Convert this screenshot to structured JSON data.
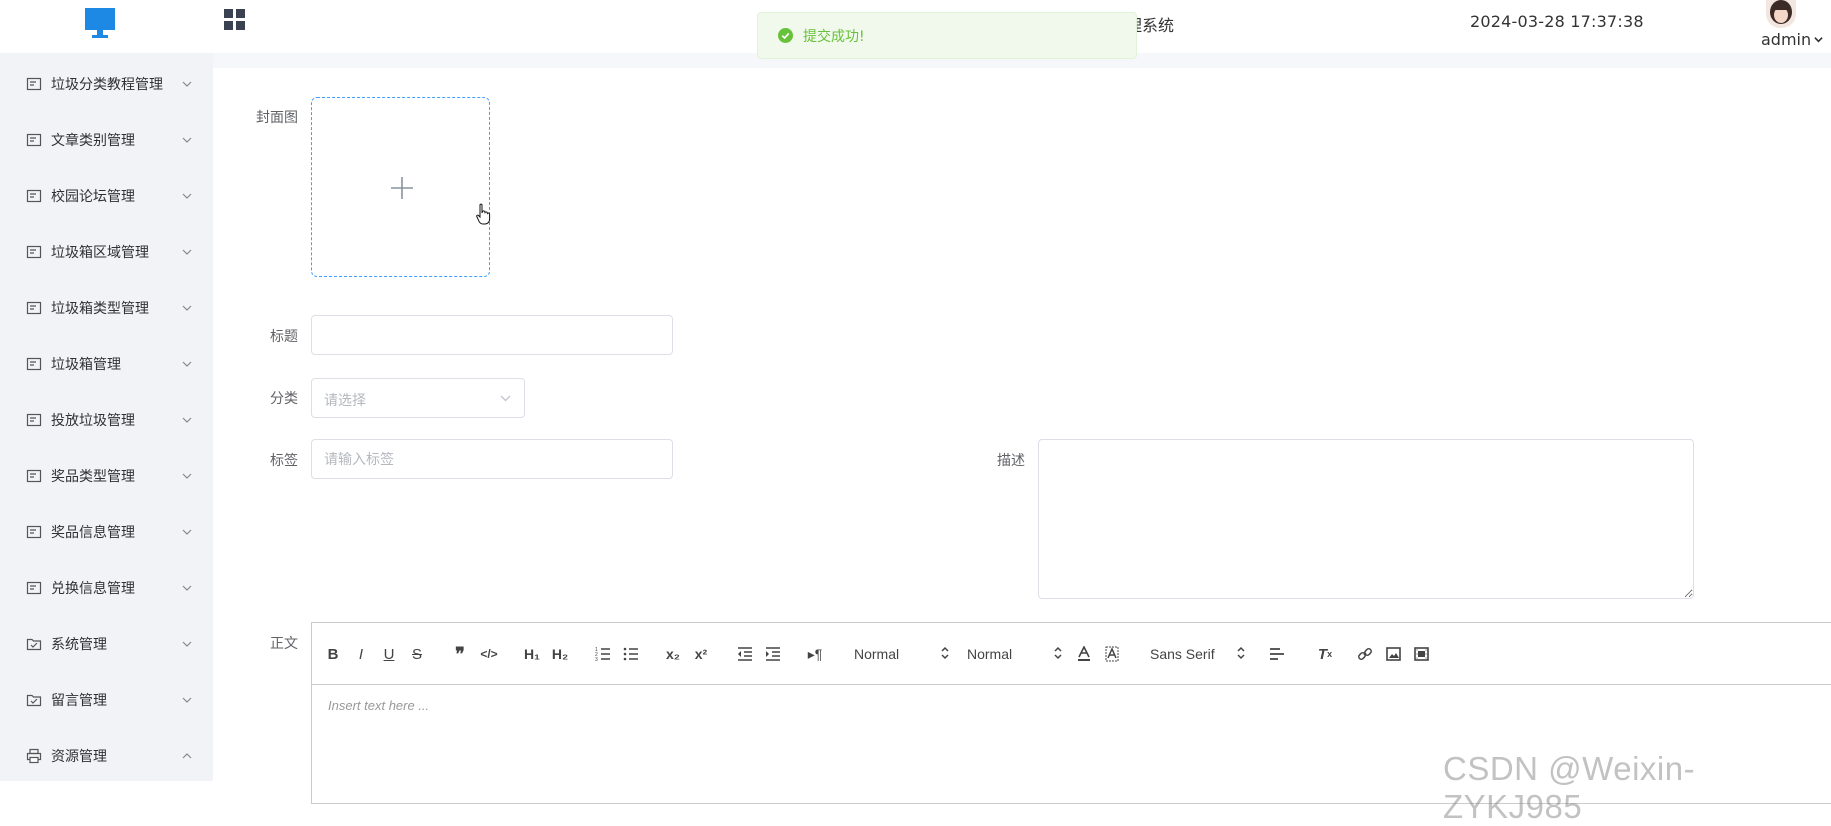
{
  "header": {
    "system_title_fragment": "理系统",
    "datetime": "2024-03-28 17:37:38",
    "user_name": "admin"
  },
  "toast": {
    "message": "提交成功!",
    "color": "#67c23a"
  },
  "sidebar": {
    "items": [
      {
        "label": "垃圾分类教程管理",
        "icon": "doc-icon",
        "expanded": false
      },
      {
        "label": "文章类别管理",
        "icon": "doc-icon",
        "expanded": false
      },
      {
        "label": "校园论坛管理",
        "icon": "doc-icon",
        "expanded": false
      },
      {
        "label": "垃圾箱区域管理",
        "icon": "doc-icon",
        "expanded": false
      },
      {
        "label": "垃圾箱类型管理",
        "icon": "doc-icon",
        "expanded": false
      },
      {
        "label": "垃圾箱管理",
        "icon": "doc-icon",
        "expanded": false
      },
      {
        "label": "投放垃圾管理",
        "icon": "doc-icon",
        "expanded": false
      },
      {
        "label": "奖品类型管理",
        "icon": "doc-icon",
        "expanded": false
      },
      {
        "label": "奖品信息管理",
        "icon": "doc-icon",
        "expanded": false
      },
      {
        "label": "兑换信息管理",
        "icon": "doc-icon",
        "expanded": false
      },
      {
        "label": "系统管理",
        "icon": "folder-check-icon",
        "expanded": false
      },
      {
        "label": "留言管理",
        "icon": "folder-check-icon",
        "expanded": false
      },
      {
        "label": "资源管理",
        "icon": "printer-icon",
        "expanded": true
      }
    ]
  },
  "form": {
    "cover_label": "封面图",
    "title_label": "标题",
    "title_value": "",
    "category_label": "分类",
    "category_placeholder": "请选择",
    "tags_label": "标签",
    "tags_placeholder": "请输入标签",
    "desc_label": "描述",
    "body_label": "正文"
  },
  "editor": {
    "header_picker": "Normal",
    "size_picker": "Normal",
    "font_picker": "Sans Serif",
    "placeholder": "Insert text here ..."
  },
  "watermark": "CSDN @Weixin-ZYKJ985",
  "colors": {
    "accent": "#409eff",
    "sidebar_bg": "#f1f3f7",
    "logo": "#1e88e5"
  }
}
